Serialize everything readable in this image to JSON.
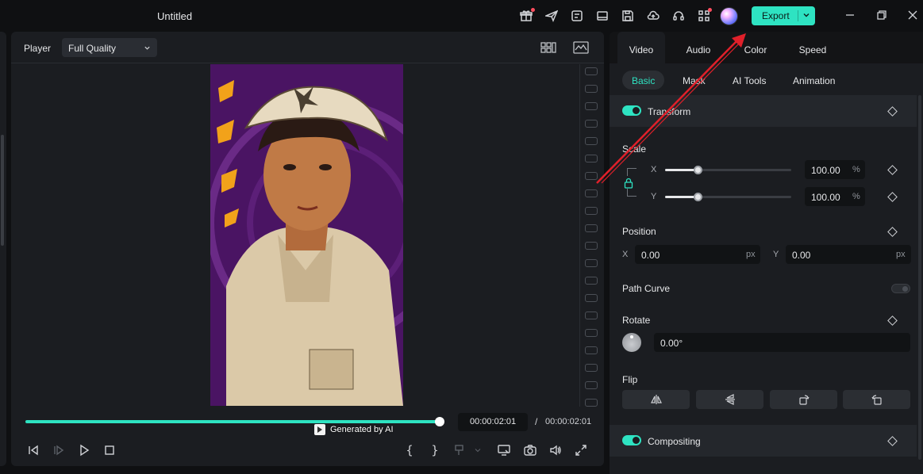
{
  "window": {
    "title": "Untitled"
  },
  "toolbar": {
    "icons": [
      "gift-icon",
      "send-icon",
      "task-icon",
      "layout-icon",
      "save-icon",
      "cloud-upload-icon",
      "headset-icon",
      "apps-icon"
    ],
    "export_label": "Export"
  },
  "player": {
    "label": "Player",
    "quality": "Full Quality",
    "watermark": "Generated by AI",
    "current_time": "00:00:02:01",
    "separator": "/",
    "total_time": "00:00:02:01",
    "progress": 1.0
  },
  "panel": {
    "tabs": [
      "Video",
      "Audio",
      "Color",
      "Speed"
    ],
    "subtabs": [
      "Basic",
      "Mask",
      "AI Tools",
      "Animation"
    ],
    "transform": {
      "title": "Transform",
      "scale_label": "Scale",
      "x_label": "X",
      "y_label": "Y",
      "scale_x": "100.00",
      "scale_y": "100.00",
      "percent": "%"
    },
    "position": {
      "label": "Position",
      "x_label": "X",
      "x_value": "0.00",
      "y_label": "Y",
      "y_value": "0.00",
      "unit": "px"
    },
    "path_curve": "Path Curve",
    "rotate": {
      "label": "Rotate",
      "value": "0.00°"
    },
    "flip": {
      "label": "Flip"
    },
    "compositing": {
      "title": "Compositing"
    }
  },
  "colors": {
    "accent": "#2ee3c2",
    "background": "#0f1012",
    "panel": "#1b1d21",
    "annotation_arrow": "#e0202a"
  }
}
